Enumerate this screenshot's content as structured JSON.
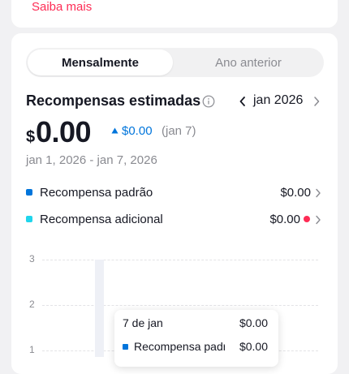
{
  "learn_more": "Saiba mais",
  "tabs": [
    {
      "label": "Mensalmente",
      "active": true
    },
    {
      "label": "Ano anterior",
      "active": false
    }
  ],
  "header": {
    "title": "Recompensas estimadas",
    "month": "jan 2026"
  },
  "summary": {
    "currency": "$",
    "amount": "0.00",
    "delta_value": "$0.00",
    "delta_date": "(jan 7)",
    "date_range": "jan 1, 2026 - jan 7, 2026"
  },
  "rows": [
    {
      "label": "Recompensa padrão",
      "value": "$0.00",
      "color": "#0075db",
      "alert": false
    },
    {
      "label": "Recompensa adicional",
      "value": "$0.00",
      "color": "#20d5ec",
      "alert": true
    }
  ],
  "chart_data": {
    "type": "bar",
    "y_ticks": [
      "3",
      "2",
      "1"
    ],
    "ylim": [
      0,
      3
    ],
    "categories": [
      "7 de jan"
    ],
    "series": [
      {
        "name": "Recompensa padrão",
        "values": [
          0.0
        ]
      },
      {
        "name": "Recompensa adicional",
        "values": [
          0.0
        ]
      }
    ]
  },
  "tooltip": {
    "date": "7 de jan",
    "total": "$0.00",
    "label": "Recompensa padrão",
    "value": "$0.00"
  },
  "colors": {
    "accent_red": "#fe2c55",
    "accent_blue": "#0075db",
    "accent_cyan": "#20d5ec"
  }
}
